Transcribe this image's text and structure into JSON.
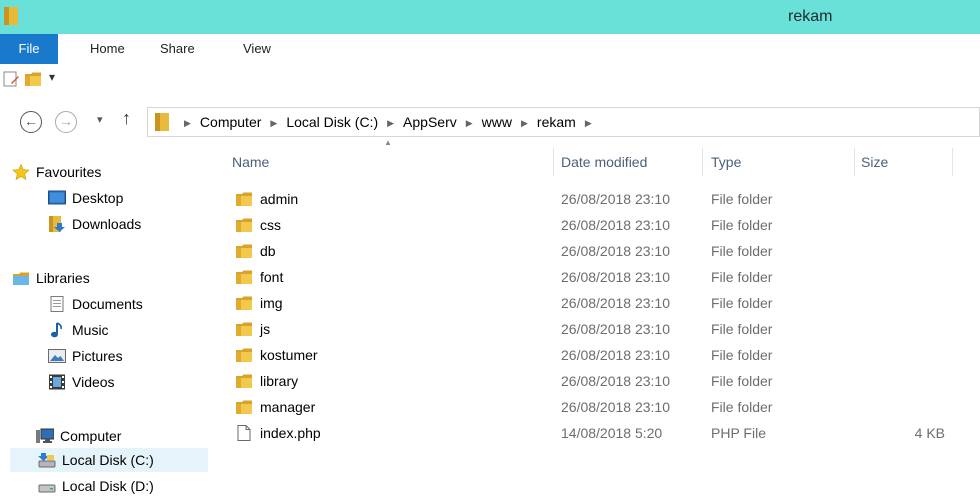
{
  "window": {
    "title": "rekam"
  },
  "ribbon": {
    "tabs": [
      "File",
      "Home",
      "Share",
      "View"
    ]
  },
  "qat": {
    "dropdown_glyph": "▾"
  },
  "address": {
    "crumbs": [
      "Computer",
      "Local Disk (C:)",
      "AppServ",
      "www",
      "rekam"
    ],
    "back_glyph": "←",
    "forward_glyph": "→",
    "recent_glyph": "▾",
    "up_glyph": "↑",
    "sep_glyph": "▶"
  },
  "navpane": {
    "favourites": {
      "label": "Favourites",
      "items": [
        "Desktop",
        "Downloads"
      ]
    },
    "libraries": {
      "label": "Libraries",
      "items": [
        "Documents",
        "Music",
        "Pictures",
        "Videos"
      ]
    },
    "computer": {
      "label": "Computer",
      "items": [
        "Local Disk (C:)",
        "Local Disk (D:)"
      ]
    }
  },
  "columns": {
    "name": "Name",
    "date": "Date modified",
    "type": "Type",
    "size": "Size"
  },
  "files": [
    {
      "name": "admin",
      "date": "26/08/2018 23:10",
      "type": "File folder",
      "size": "",
      "icon": "folder-icon"
    },
    {
      "name": "css",
      "date": "26/08/2018 23:10",
      "type": "File folder",
      "size": "",
      "icon": "folder-icon"
    },
    {
      "name": "db",
      "date": "26/08/2018 23:10",
      "type": "File folder",
      "size": "",
      "icon": "folder-icon"
    },
    {
      "name": "font",
      "date": "26/08/2018 23:10",
      "type": "File folder",
      "size": "",
      "icon": "folder-icon"
    },
    {
      "name": "img",
      "date": "26/08/2018 23:10",
      "type": "File folder",
      "size": "",
      "icon": "folder-icon"
    },
    {
      "name": "js",
      "date": "26/08/2018 23:10",
      "type": "File folder",
      "size": "",
      "icon": "folder-icon"
    },
    {
      "name": "kostumer",
      "date": "26/08/2018 23:10",
      "type": "File folder",
      "size": "",
      "icon": "folder-icon"
    },
    {
      "name": "library",
      "date": "26/08/2018 23:10",
      "type": "File folder",
      "size": "",
      "icon": "folder-icon"
    },
    {
      "name": "manager",
      "date": "26/08/2018 23:10",
      "type": "File folder",
      "size": "",
      "icon": "folder-icon"
    },
    {
      "name": "index.php",
      "date": "14/08/2018 5:20",
      "type": "PHP File",
      "size": "4 KB",
      "icon": "file-icon"
    }
  ],
  "colors": {
    "titlebar": "#69e0d8",
    "file_tab": "#1979ca",
    "folder": "#e8b93a",
    "selection": "#e5f3fb"
  }
}
